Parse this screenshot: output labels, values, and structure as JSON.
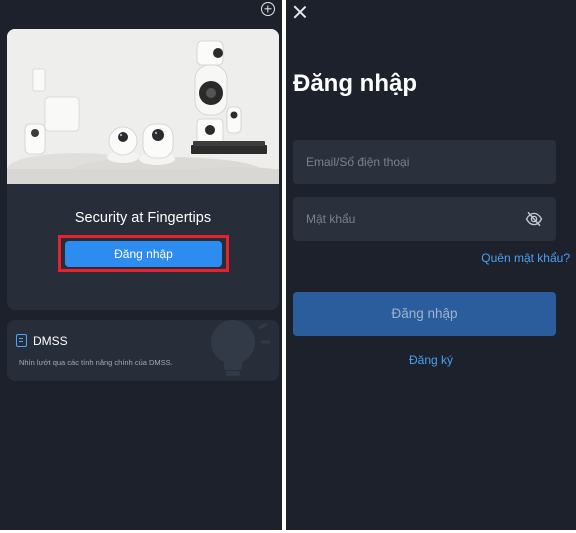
{
  "home": {
    "hero_title": "Security at Fingertips",
    "login_button": "Đăng nhập",
    "dmss_card": {
      "title": "DMSS",
      "description": "Nhìn lướt qua các tính năng chính của DMSS."
    },
    "icons": {
      "add": "plus-circle-icon",
      "dmss": "document-icon",
      "decoration": "lightbulb-icon"
    },
    "highlight_color": "#e8212b"
  },
  "login": {
    "title": "Đăng nhập",
    "email_placeholder": "Email/Số điện thoại",
    "email_value": "",
    "password_placeholder": "Mật khẩu",
    "password_value": "",
    "forgot_password": "Quên mật khẩu?",
    "login_button": "Đăng nhập",
    "register_link": "Đăng ký",
    "icons": {
      "close": "close-icon",
      "password_visibility": "eye-off-icon"
    }
  },
  "colors": {
    "background": "#1c212b",
    "card": "#272d39",
    "accent": "#2d8cf0",
    "link": "#4aa0f4",
    "disabled_button": "#2b5d9c"
  }
}
